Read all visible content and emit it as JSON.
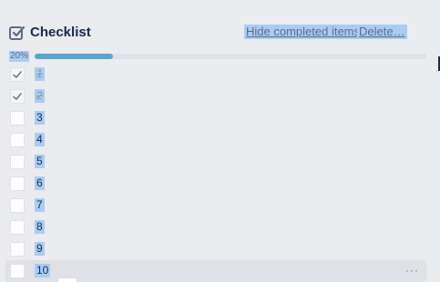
{
  "checklist": {
    "title": "Checklist",
    "hide_completed_label": "Hide completed items",
    "delete_label": "Delete…",
    "progress_label": "20%",
    "progress_value": 0.2,
    "items": [
      {
        "label": "1",
        "done": true
      },
      {
        "label": "2",
        "done": true
      },
      {
        "label": "3",
        "done": false
      },
      {
        "label": "4",
        "done": false
      },
      {
        "label": "5",
        "done": false
      },
      {
        "label": "6",
        "done": false
      },
      {
        "label": "7",
        "done": false
      },
      {
        "label": "8",
        "done": false
      },
      {
        "label": "9",
        "done": false
      },
      {
        "label": "10",
        "done": false
      }
    ],
    "more_label": "···"
  },
  "colors": {
    "background": "#ebecf0",
    "progress_fill": "#5ba4cf",
    "progress_track": "#dfe1e6",
    "selection": "#a9cdf2"
  }
}
